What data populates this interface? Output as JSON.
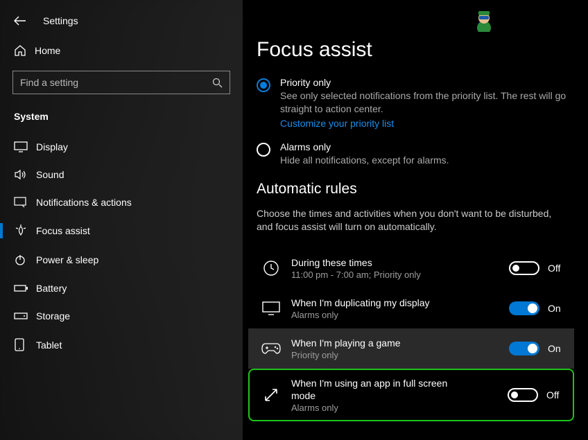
{
  "header": {
    "title": "Settings"
  },
  "home": {
    "label": "Home"
  },
  "search": {
    "placeholder": "Find a setting"
  },
  "section": {
    "label": "System"
  },
  "nav": [
    {
      "label": "Display"
    },
    {
      "label": "Sound"
    },
    {
      "label": "Notifications & actions"
    },
    {
      "label": "Focus assist"
    },
    {
      "label": "Power & sleep"
    },
    {
      "label": "Battery"
    },
    {
      "label": "Storage"
    },
    {
      "label": "Tablet"
    }
  ],
  "page": {
    "title": "Focus assist"
  },
  "radios": {
    "priority": {
      "title": "Priority only",
      "desc": "See only selected notifications from the priority list. The rest will go straight to action center.",
      "link": "Customize your priority list"
    },
    "alarms": {
      "title": "Alarms only",
      "desc": "Hide all notifications, except for alarms."
    }
  },
  "auto": {
    "heading": "Automatic rules",
    "desc": "Choose the times and activities when you don't want to be disturbed, and focus assist will turn on automatically."
  },
  "rules": [
    {
      "title": "During these times",
      "sub": "11:00 pm - 7:00 am; Priority only",
      "state": "Off"
    },
    {
      "title": "When I'm duplicating my display",
      "sub": "Alarms only",
      "state": "On"
    },
    {
      "title": "When I'm playing a game",
      "sub": "Priority only",
      "state": "On"
    },
    {
      "title": "When I'm using an app in full screen mode",
      "sub": "Alarms only",
      "state": "Off"
    }
  ]
}
